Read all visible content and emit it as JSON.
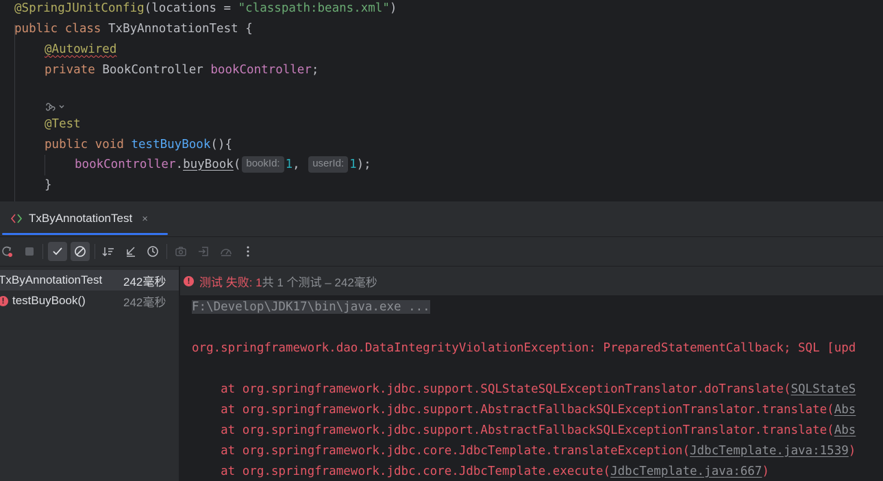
{
  "editor": {
    "l1_ann": "@SpringJUnitConfig",
    "l1_open": "(locations = ",
    "l1_str": "\"classpath:beans.xml\"",
    "l1_close": ")",
    "l2_kw1": "public",
    "l2_kw2": "class",
    "l2_name": "TxByAnnotationTest",
    "l2_brace": "{",
    "l3_ann": "@Autowired",
    "l4_kw": "private",
    "l4_type": "BookController",
    "l4_field": "bookController",
    "l4_semi": ";",
    "l6_ann": "@Test",
    "l7_kw1": "public",
    "l7_kw2": "void",
    "l7_fn": "testBuyBook",
    "l7_rest": "(){",
    "l8_field": "bookController",
    "l8_dot": ".",
    "l8_fn": "buyBook",
    "l8_open": "(",
    "hint_bookId": "bookId:",
    "arg1": "1",
    "comma": ", ",
    "hint_userId": "userId:",
    "arg2": "1",
    "l8_close": ");",
    "l9_brace": "}"
  },
  "tool_window": {
    "tab_label": "TxByAnnotationTest",
    "tab_close": "×"
  },
  "toolbar": {
    "icons": [
      "rerun-failed-icon",
      "stop-icon",
      "show-passed-icon",
      "show-ignored-icon",
      "sort-alpha-icon",
      "collapse-icon",
      "sort-duration-icon",
      "screenshot-icon",
      "import-icon",
      "coverage-icon",
      "more-icon"
    ]
  },
  "tree": {
    "root_label": "TxByAnnotationTest",
    "root_time": "242毫秒",
    "child_label": "testBuyBook()",
    "child_time": "242毫秒"
  },
  "status": {
    "failed": "测试 失败: 1",
    "summary": "共 1 个测试 – 242毫秒"
  },
  "console": {
    "cmd": "F:\\Develop\\JDK17\\bin\\java.exe ...",
    "exception": "org.springframework.dao.DataIntegrityViolationException: PreparedStatementCallback; SQL [upd",
    "frames": [
      {
        "text": "    at org.springframework.jdbc.support.SQLStateSQLExceptionTranslator.doTranslate(",
        "link": "SQLStateS",
        "tail": ""
      },
      {
        "text": "    at org.springframework.jdbc.support.AbstractFallbackSQLExceptionTranslator.translate(",
        "link": "Abs",
        "tail": ""
      },
      {
        "text": "    at org.springframework.jdbc.support.AbstractFallbackSQLExceptionTranslator.translate(",
        "link": "Abs",
        "tail": ""
      },
      {
        "text": "    at org.springframework.jdbc.core.JdbcTemplate.translateException(",
        "link": "JdbcTemplate.java:1539",
        "tail": ")"
      },
      {
        "text": "    at org.springframework.jdbc.core.JdbcTemplate.execute(",
        "link": "JdbcTemplate.java:667",
        "tail": ")"
      }
    ]
  },
  "colors": {
    "editor_bg": "#1e1f22",
    "panel_bg": "#2b2d30",
    "keyword": "#cf8e6d",
    "annotation": "#b3ae60",
    "string": "#6aab73",
    "function": "#56a8f5",
    "field": "#c77dbb",
    "number": "#2aacb8",
    "error": "#e55765",
    "accent": "#3574f0"
  }
}
